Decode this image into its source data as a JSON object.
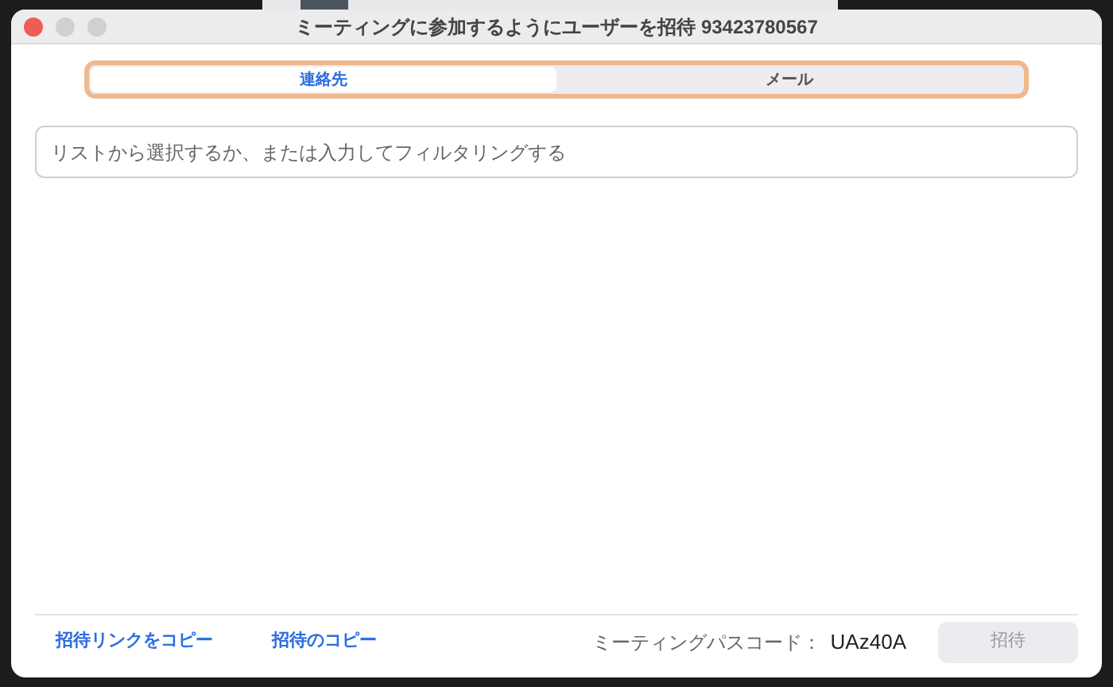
{
  "window": {
    "title": "ミーティングに参加するようにユーザーを招待 93423780567"
  },
  "tabs": [
    {
      "label": "連絡先",
      "selected": true
    },
    {
      "label": "メール",
      "selected": false
    }
  ],
  "search": {
    "placeholder": "リストから選択するか、または入力してフィルタリングする"
  },
  "footer": {
    "links": [
      "招待リンクをコピー",
      "招待のコピー"
    ],
    "passcode_label": "ミーティングパスコード：",
    "passcode": "UAz40A",
    "invite_button": {
      "label": "招待",
      "disabled": true
    }
  }
}
